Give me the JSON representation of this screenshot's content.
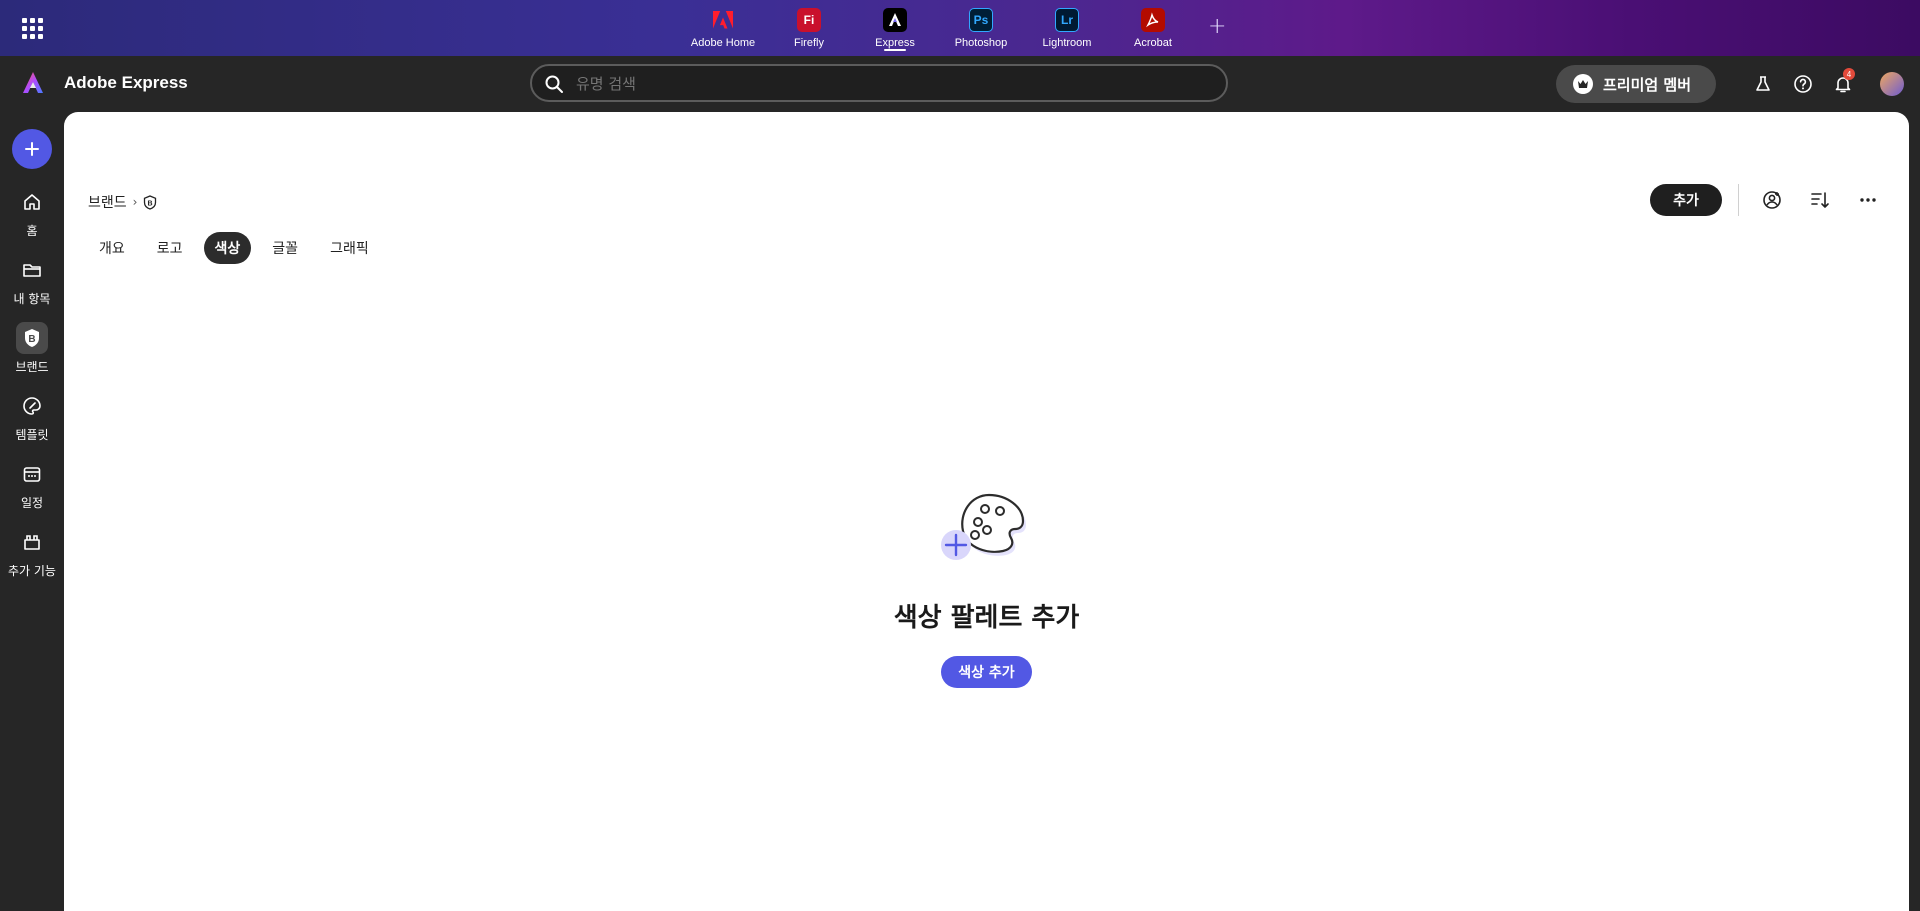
{
  "topbar": {
    "apps": [
      {
        "label": "Adobe Home",
        "icon": "adobe-logo-icon",
        "bg": "transparent",
        "fg": "#e8102a",
        "active": false
      },
      {
        "label": "Firefly",
        "icon_text": "Fi",
        "bg": "#c9102c",
        "fg": "#ffffff",
        "active": false
      },
      {
        "label": "Express",
        "icon": "express-logo-icon",
        "bg": "#000000",
        "fg": "#ffffff",
        "active": true
      },
      {
        "label": "Photoshop",
        "icon_text": "Ps",
        "bg": "#001e36",
        "fg": "#31a8ff",
        "active": false
      },
      {
        "label": "Lightroom",
        "icon_text": "Lr",
        "bg": "#001a33",
        "fg": "#31a8ff",
        "active": false
      },
      {
        "label": "Acrobat",
        "icon": "acrobat-icon",
        "bg": "#b30b00",
        "fg": "#ffffff",
        "active": false
      }
    ],
    "add_app_label": "+"
  },
  "header": {
    "brand": "Adobe Express",
    "search_placeholder": "유명 검색",
    "premium_label": "프리미엄 멤버",
    "notification_count": "4"
  },
  "sidebar": {
    "create_label": "+",
    "items": [
      {
        "label": "홈",
        "icon": "home-icon",
        "active": false
      },
      {
        "label": "내 항목",
        "icon": "folder-icon",
        "active": false
      },
      {
        "label": "브랜드",
        "icon": "brand-icon",
        "active": true
      },
      {
        "label": "템플릿",
        "icon": "template-icon",
        "active": false
      },
      {
        "label": "일정",
        "icon": "calendar-icon",
        "active": false
      },
      {
        "label": "추가 기능",
        "icon": "addons-icon",
        "active": false
      }
    ]
  },
  "main": {
    "breadcrumb": {
      "root": "브랜드",
      "separator": "›"
    },
    "tabs": [
      {
        "label": "개요",
        "active": false
      },
      {
        "label": "로고",
        "active": false
      },
      {
        "label": "색상",
        "active": true
      },
      {
        "label": "글꼴",
        "active": false
      },
      {
        "label": "그래픽",
        "active": false
      }
    ],
    "add_button": "추가",
    "empty_state": {
      "title": "색상 팔레트 추가",
      "button": "색상 추가"
    }
  },
  "colors": {
    "accent": "#5258e4",
    "chrome": "#262626"
  }
}
